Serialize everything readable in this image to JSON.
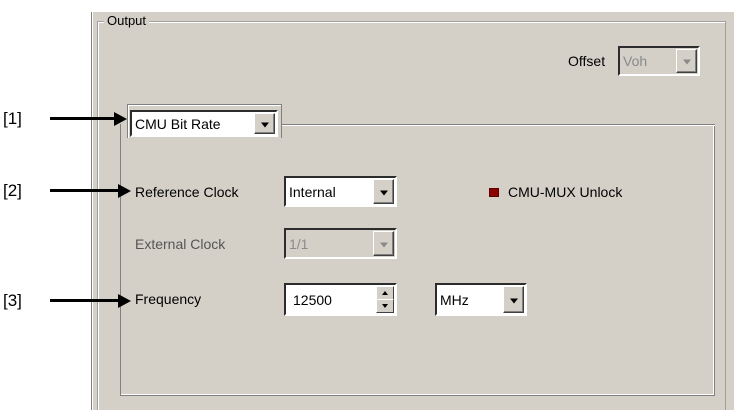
{
  "output_group": {
    "legend": "Output",
    "offset": {
      "label": "Offset",
      "value": "Voh"
    },
    "mode_select": {
      "value": "CMU Bit Rate"
    },
    "reference_clock": {
      "label": "Reference Clock",
      "value": "Internal"
    },
    "external_clock": {
      "label": "External Clock",
      "value": "1/1"
    },
    "frequency": {
      "label": "Frequency",
      "value": "12500",
      "unit": "MHz"
    },
    "unlock_indicator": {
      "label": "CMU-MUX Unlock",
      "color": "#8b0000"
    }
  },
  "callouts": [
    "[1]",
    "[2]",
    "[3]"
  ]
}
